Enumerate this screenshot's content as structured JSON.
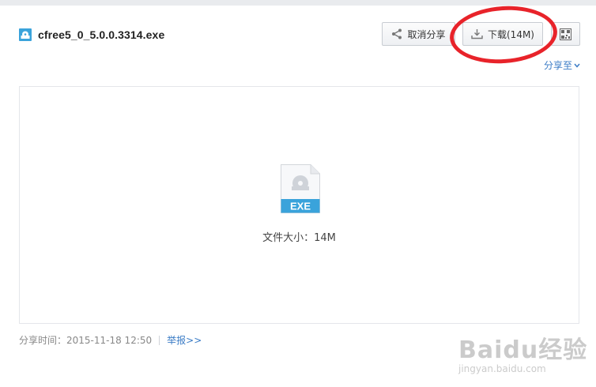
{
  "file": {
    "name": "cfree5_0_5.0.0.3314.exe",
    "type_badge": "EXE",
    "size_label": "文件大小：14M"
  },
  "toolbar": {
    "cancel_share_label": "取消分享",
    "download_label": "下载(14M)",
    "share_to_label": "分享至"
  },
  "meta": {
    "share_time": "分享时间：2015-11-18 12:50",
    "report_label": "举报>>"
  },
  "watermark": {
    "logo_text": "Baidu经验",
    "url": "jingyan.baidu.com"
  },
  "colors": {
    "accent": "#3b7cc6",
    "exe_badge": "#3aa3db",
    "annotation": "#e8232a"
  },
  "icons": {
    "file_header": "exe-file-icon",
    "cancel_share": "share-icon",
    "download": "download-icon",
    "qr": "qr-code-icon",
    "share_to_caret": "chevron-down-icon"
  }
}
